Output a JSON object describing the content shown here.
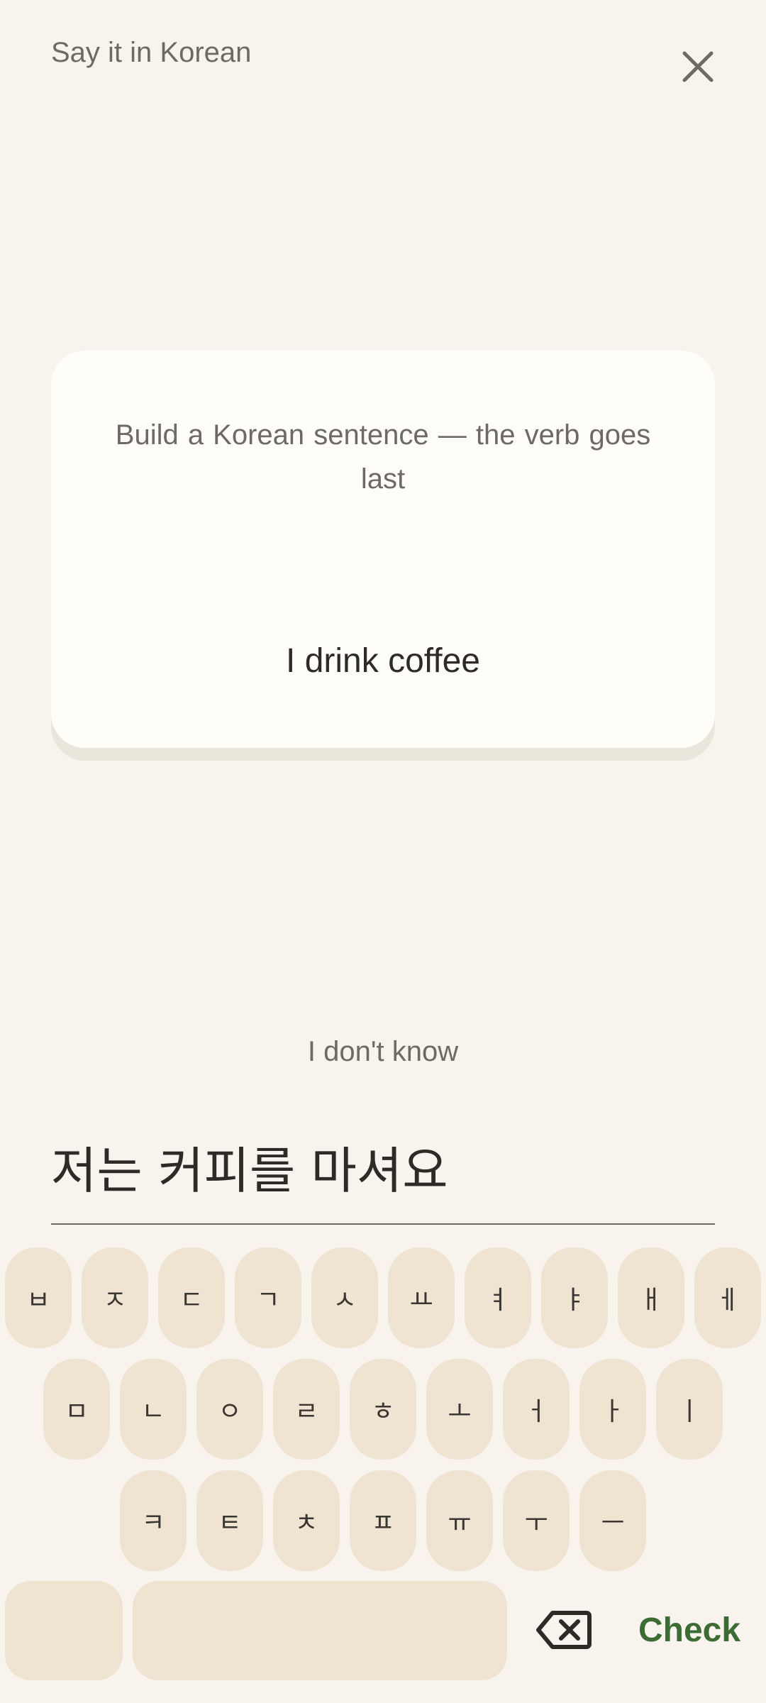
{
  "header": {
    "title": "Say it in Korean"
  },
  "card": {
    "instruction": "Build a Korean sentence — the verb goes last",
    "sentence": "I drink coffee"
  },
  "dont_know": "I don't know",
  "answer": {
    "value": "저는 커피를 마셔요"
  },
  "keyboard": {
    "row1": [
      "ㅂ",
      "ㅈ",
      "ㄷ",
      "ㄱ",
      "ㅅ",
      "ㅛ",
      "ㅕ",
      "ㅑ",
      "ㅐ",
      "ㅔ"
    ],
    "row2": [
      "ㅁ",
      "ㄴ",
      "ㅇ",
      "ㄹ",
      "ㅎ",
      "ㅗ",
      "ㅓ",
      "ㅏ",
      "ㅣ"
    ],
    "row3": [
      "ㅋ",
      "ㅌ",
      "ㅊ",
      "ㅍ",
      "ㅠ",
      "ㅜ",
      "ㅡ"
    ],
    "check_label": "Check"
  },
  "colors": {
    "background": "#f8f4ed",
    "key": "#efe3d2",
    "check": "#3d6b34"
  }
}
